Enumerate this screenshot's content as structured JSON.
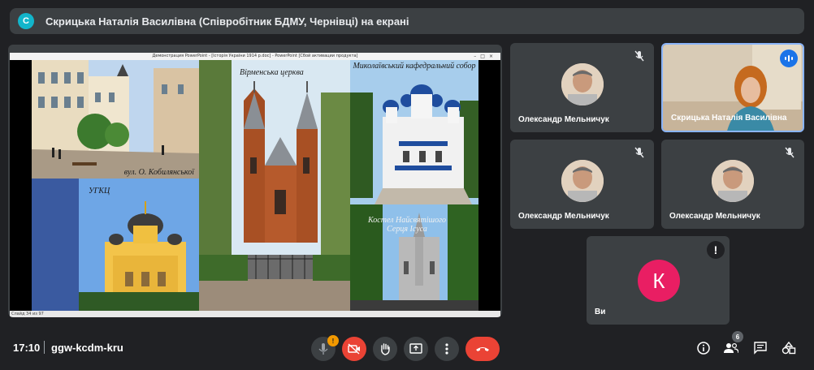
{
  "banner": {
    "avatar_letter": "С",
    "text": "Скрицька Наталія Василівна (Співробітник БДМУ, Чернівці) на екрані"
  },
  "presentation": {
    "titlebar": "Демонстрация PowerPoint - [Історія України 1914 р.doc] - PowerPoint [Сбой активации продукта]",
    "statusbar": "Слайд 34 из 97",
    "captions": {
      "armenian_church": "Вірменська церква",
      "nicholas_cathedral": "Миколаївський кафедральний собор",
      "kobylianska_street": "вул. О. Кобилянської",
      "ugcc": "УГКЦ",
      "sacred_heart": "Костел Найсвятішого Серця Ісуса"
    }
  },
  "tiles": [
    {
      "name": "Олександр Мельничук"
    },
    {
      "name": "Скрицька Наталія Василівна"
    },
    {
      "name": "Олександр Мельничук"
    },
    {
      "name": "Олександр Мельничук"
    },
    {
      "name": "Ви",
      "avatar_letter": "К"
    }
  ],
  "bottom_bar": {
    "time": "17:10",
    "meeting_code": "ggw-kcdm-kru",
    "mic_badge": "!",
    "people_count": "6"
  },
  "colors": {
    "background": "#202124",
    "tile": "#3c4043",
    "accent_blue": "#8ab4f8",
    "hangup_red": "#ea4335",
    "self_avatar": "#e91e63"
  }
}
